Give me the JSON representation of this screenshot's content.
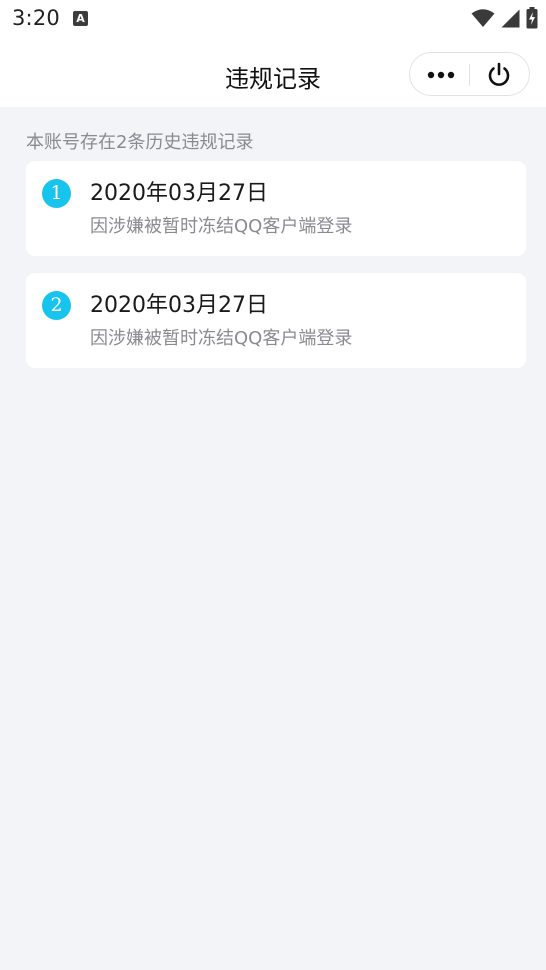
{
  "status_bar": {
    "time": "3:20",
    "notification_icon_letter": "A",
    "icons": [
      "wifi-icon",
      "signal-icon",
      "battery-charging-icon"
    ]
  },
  "nav": {
    "title": "违规记录",
    "capsule_icons": [
      "more-icon",
      "power-icon"
    ]
  },
  "summary": "本账号存在2条历史违规记录",
  "records": [
    {
      "index": "1",
      "date": "2020年03月27日",
      "reason": "因涉嫌被暂时冻结QQ客户端登录"
    },
    {
      "index": "2",
      "date": "2020年03月27日",
      "reason": "因涉嫌被暂时冻结QQ客户端登录"
    }
  ],
  "colors": {
    "accent_badge": "#17c4ee",
    "background": "#f3f4f8",
    "card": "#ffffff",
    "secondary_text": "#8a8a92"
  }
}
